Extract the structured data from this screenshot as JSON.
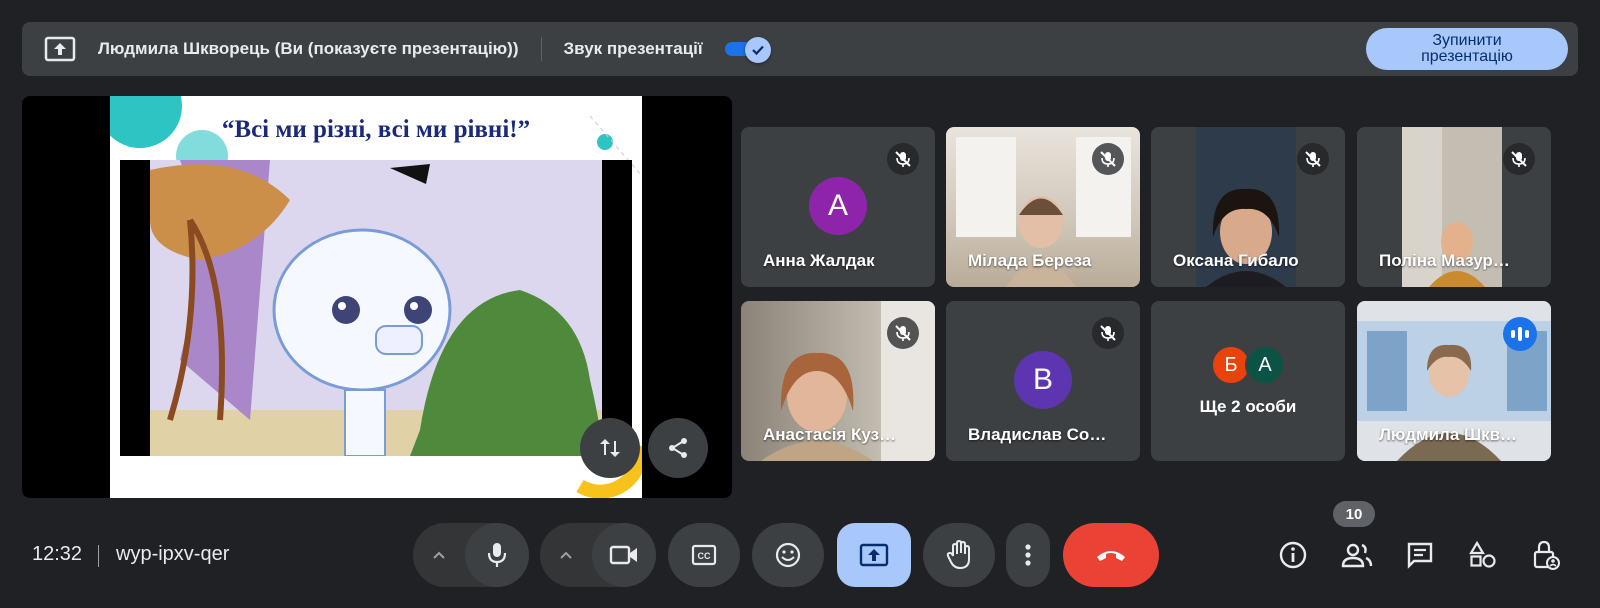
{
  "banner": {
    "presenter_label": "Людмила Шкворець (Ви (показуєте презентацію))",
    "audio_label": "Звук презентації",
    "audio_enabled": true,
    "stop_button_label": "Зупинити презентацію",
    "share_icon": "present-screen-icon"
  },
  "presentation": {
    "slide_title": "“Всі ми різні, всі ми рівні!”",
    "buttons": [
      "swap-layout-icon",
      "share-icon"
    ]
  },
  "tiles": [
    {
      "name": "Анна Жалдак",
      "type": "avatar",
      "initial": "A",
      "avatar_color": "#8e24aa",
      "muted": true
    },
    {
      "name": "Мілада Береза",
      "type": "video",
      "muted": true
    },
    {
      "name": "Оксана Гибало",
      "type": "video",
      "muted": true
    },
    {
      "name": "Поліна Мазур…",
      "type": "video",
      "muted": true
    },
    {
      "name": "Анастасія Куз…",
      "type": "video",
      "muted": true
    },
    {
      "name": "Владислав Со…",
      "type": "avatar",
      "initial": "B",
      "avatar_color": "#5e35b1",
      "muted": true
    },
    {
      "name": "Ще 2 особи",
      "type": "group",
      "initials": [
        "Б",
        "A"
      ],
      "colors": [
        "#e8430d",
        "#0b5345"
      ]
    },
    {
      "name": "Людмила Шкв…",
      "type": "video",
      "speaking": true,
      "active": true
    }
  ],
  "bottom": {
    "time": "12:32",
    "meeting_code": "wyp-ipxv-qer",
    "participants_count": "10",
    "controls": [
      "chevron-up-icon",
      "mic-icon",
      "chevron-up-icon",
      "camera-icon",
      "captions-icon",
      "emoji-icon",
      "present-screen-icon",
      "raise-hand-icon",
      "more-vert-icon",
      "end-call-icon"
    ],
    "right_icons": [
      "info-icon",
      "people-icon",
      "chat-icon",
      "activities-icon",
      "host-controls-icon"
    ]
  },
  "colors": {
    "background": "#202124",
    "surface": "#3c4043",
    "accent": "#a8c7fa",
    "end_call": "#ea4335",
    "speaking": "#1a73e8"
  }
}
